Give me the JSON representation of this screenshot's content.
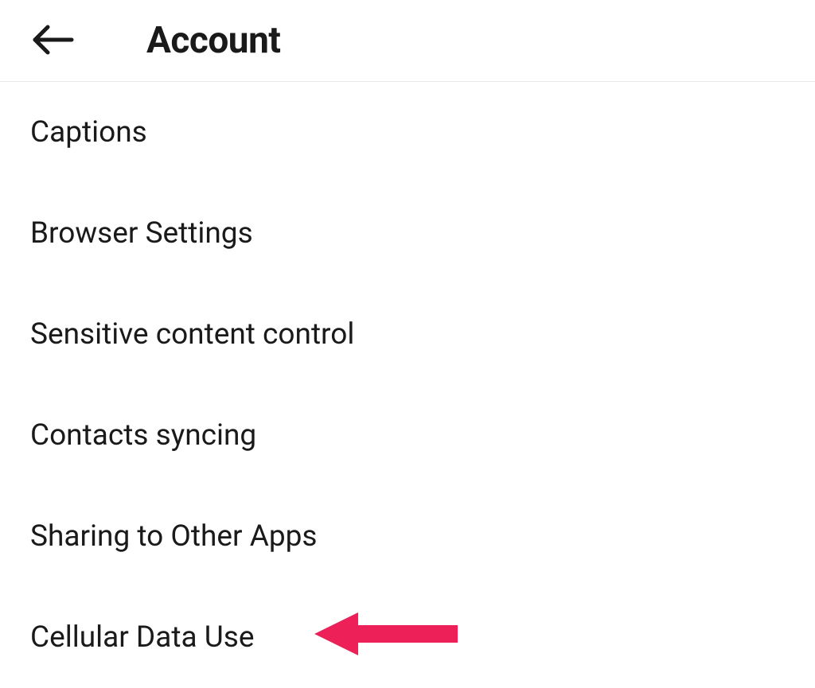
{
  "header": {
    "title": "Account"
  },
  "settings": {
    "items": [
      {
        "label": "Captions"
      },
      {
        "label": "Browser Settings"
      },
      {
        "label": "Sensitive content control"
      },
      {
        "label": "Contacts syncing"
      },
      {
        "label": "Sharing to Other Apps"
      },
      {
        "label": "Cellular Data Use"
      }
    ]
  },
  "annotation": {
    "color": "#ed2057",
    "target_index": 5
  }
}
